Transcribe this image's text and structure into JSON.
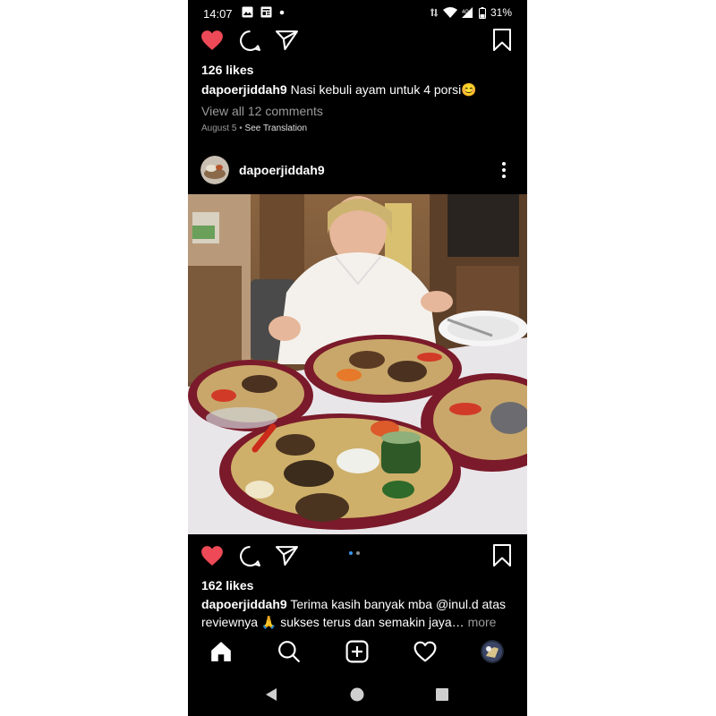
{
  "status_bar": {
    "time": "14:07",
    "battery": "31%"
  },
  "post1": {
    "likes": "126 likes",
    "username": "dapoerjiddah9",
    "caption": "Nasi kebuli ayam untuk 4 porsi😊",
    "view_comments": "View all 12 comments",
    "date": "August 5",
    "separator": " • ",
    "see_translation": "See Translation"
  },
  "post2": {
    "username": "dapoerjiddah9",
    "likes": "162 likes",
    "caption_user": "dapoerjiddah9",
    "caption_line1": "Terima kasih banyak mba @inul.d atas",
    "caption_line2": "reviewnya 🙏 sukses terus dan semakin jaya…",
    "more": "more"
  },
  "colors": {
    "background": "#000000",
    "heart_liked": "#ed4956",
    "carousel_active": "#3897f0",
    "carousel_inactive": "#8c8c8c",
    "muted_text": "#9a9a9a"
  },
  "icons": {
    "action_bar": [
      "heart-icon",
      "comment-icon",
      "share-icon",
      "bookmark-icon"
    ],
    "nav_bar": [
      "home-icon",
      "search-icon",
      "add-post-icon",
      "activity-heart-icon",
      "profile-avatar"
    ],
    "system_nav": [
      "back-icon",
      "home-circle-icon",
      "recents-icon"
    ]
  }
}
